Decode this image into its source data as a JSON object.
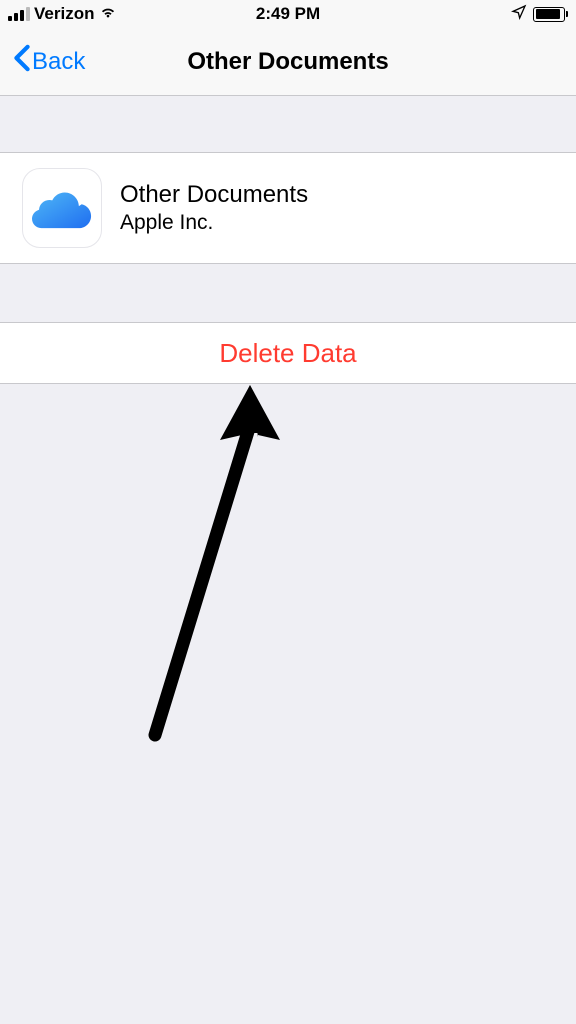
{
  "status_bar": {
    "carrier": "Verizon",
    "time": "2:49 PM"
  },
  "nav": {
    "back_label": "Back",
    "title": "Other Documents"
  },
  "app": {
    "title": "Other Documents",
    "subtitle": "Apple Inc."
  },
  "actions": {
    "delete_label": "Delete Data"
  }
}
